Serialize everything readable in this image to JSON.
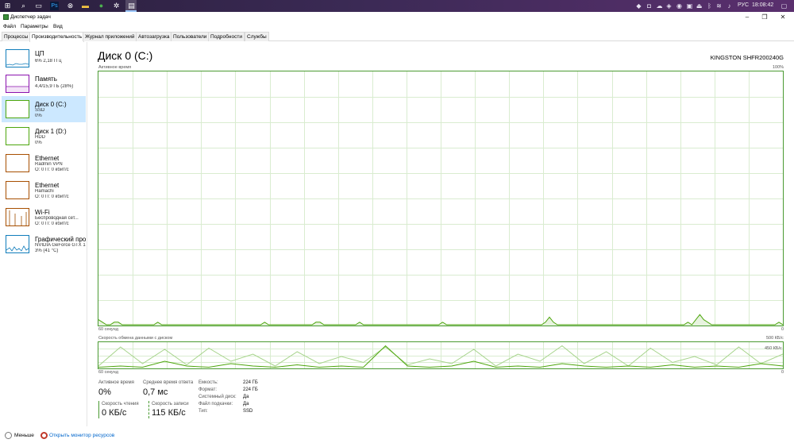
{
  "taskbar": {
    "lang": "РУС",
    "time": "18:08:42"
  },
  "window": {
    "title": "Диспетчер задач"
  },
  "menu": [
    "Файл",
    "Параметры",
    "Вид"
  ],
  "tabs": [
    {
      "label": "Процессы",
      "active": false
    },
    {
      "label": "Производительность",
      "active": true
    },
    {
      "label": "Журнал приложений",
      "active": false
    },
    {
      "label": "Автозагрузка",
      "active": false
    },
    {
      "label": "Пользователи",
      "active": false
    },
    {
      "label": "Подробности",
      "active": false
    },
    {
      "label": "Службы",
      "active": false
    }
  ],
  "sidebar": {
    "items": [
      {
        "name": "ЦП",
        "sub1": "6% 2,18 ГГц",
        "sub2": "",
        "thumb_color": "#117dbb",
        "selected": false
      },
      {
        "name": "Память",
        "sub1": "4,4/15,9 ГБ (28%)",
        "sub2": "",
        "thumb_color": "#8b12ae",
        "selected": false
      },
      {
        "name": "Диск 0 (C:)",
        "sub1": "SSD",
        "sub2": "0%",
        "thumb_color": "#4da60c",
        "selected": true
      },
      {
        "name": "Диск 1 (D:)",
        "sub1": "HDD",
        "sub2": "0%",
        "thumb_color": "#4da60c",
        "selected": false
      },
      {
        "name": "Ethernet",
        "sub1": "Radmin VPN",
        "sub2": "О: 0 П: 0 кбит/с",
        "thumb_color": "#a74f01",
        "selected": false
      },
      {
        "name": "Ethernet",
        "sub1": "Hamachi",
        "sub2": "О: 0 П: 0 кбит/с",
        "thumb_color": "#a74f01",
        "selected": false
      },
      {
        "name": "Wi-Fi",
        "sub1": "Беспроводная сет...",
        "sub2": "О: 0 П: 0 кбит/с",
        "thumb_color": "#a74f01",
        "selected": false
      },
      {
        "name": "Графический про",
        "sub1": "NVIDIA GeForce GTX 16",
        "sub2": "3% (41 °C)",
        "thumb_color": "#117dbb",
        "selected": false
      }
    ]
  },
  "main": {
    "title": "Диск 0 (C:)",
    "model": "KINGSTON SHFR200240G",
    "active_graph": {
      "label": "Активное время",
      "max_label": "100%",
      "time_label": "60 секунд",
      "min_label": "0"
    },
    "transfer_graph": {
      "label": "Скорость обмена данными с диском",
      "max_label": "500 КБ/с",
      "mid_label": "450 КБ/с",
      "time_label": "60 секунд",
      "min_label": "0"
    }
  },
  "stats": {
    "active_time_label": "Активное время",
    "active_time_value": "0%",
    "avg_response_label": "Среднее время ответа",
    "avg_response_value": "0,7 мс",
    "read_speed_label": "Скорость чтения",
    "read_speed_value": "0 КБ/с",
    "write_speed_label": "Скорость записи",
    "write_speed_value": "115 КБ/с"
  },
  "specs": [
    {
      "label": "Емкость:",
      "value": "224 ГБ"
    },
    {
      "label": "Формат:",
      "value": "224 ГБ"
    },
    {
      "label": "Системный диск:",
      "value": "Да"
    },
    {
      "label": "Файл подкачки:",
      "value": "Да"
    },
    {
      "label": "Тип:",
      "value": "SSD"
    }
  ],
  "footer": {
    "less_label": "Меньше",
    "monitor_label": "Открыть монитор ресурсов"
  },
  "chart_data": {
    "type": "line",
    "active_time_percent": [
      2,
      1,
      0,
      0,
      1,
      1,
      0,
      0,
      0,
      0,
      0,
      0,
      0,
      0,
      0,
      1,
      0,
      0,
      0,
      0,
      0,
      0,
      0,
      0,
      0,
      0,
      0,
      0,
      0,
      0,
      0,
      0,
      0,
      0,
      0,
      0,
      0,
      0,
      0,
      0,
      0,
      0,
      1,
      0,
      0,
      0,
      0,
      0,
      0,
      0,
      0,
      0,
      0,
      0,
      0,
      1,
      1,
      0,
      0,
      0,
      0,
      0,
      0,
      0,
      0,
      0,
      1,
      0,
      0,
      0,
      0,
      0,
      0,
      0,
      0,
      0,
      0,
      0,
      0,
      0,
      0,
      0,
      0,
      0,
      0,
      0,
      0,
      1,
      0,
      0,
      0,
      0,
      0,
      0,
      0,
      0,
      0,
      0,
      0,
      0,
      0,
      0,
      0,
      0,
      0,
      0,
      0,
      0,
      0,
      0,
      0,
      0,
      0,
      1,
      3,
      1,
      0,
      0,
      0,
      0,
      0,
      0,
      0,
      0,
      0,
      0,
      0,
      0,
      0,
      0,
      0,
      0,
      0,
      0,
      0,
      0,
      0,
      0,
      0,
      0,
      0,
      0,
      0,
      0,
      0,
      0,
      0,
      0,
      0,
      1,
      0,
      2,
      4,
      2,
      1,
      0,
      0,
      0,
      0,
      0,
      0,
      0,
      0,
      0,
      0,
      0,
      0,
      0,
      0,
      0,
      0,
      0,
      1,
      0
    ]
  }
}
